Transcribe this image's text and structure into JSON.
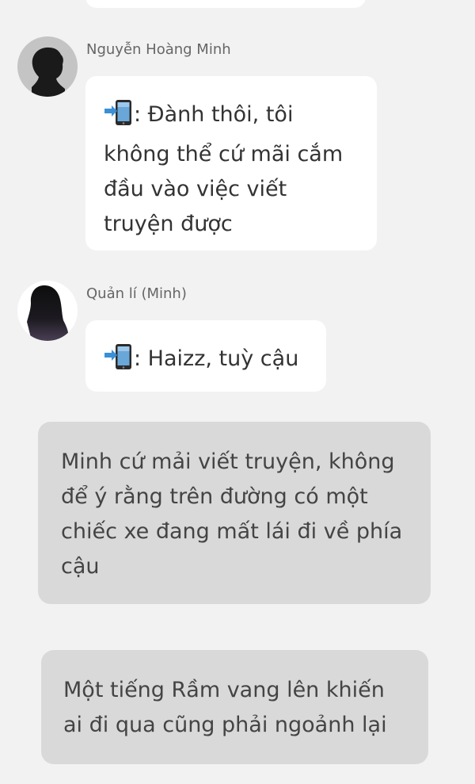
{
  "messages": [
    {
      "sender": "Nguyễn Hoàng Minh",
      "text": ": Đành thôi, tôi không thể cứ mãi cắm đầu vào việc viết truyện được"
    },
    {
      "sender": "Quản lí (Minh)",
      "text": ": Haizz, tuỳ cậu"
    }
  ],
  "narrations": [
    {
      "text": "Minh cứ mải viết truyện, không để ý rằng trên đường có một chiếc xe đang mất lái đi về phía cậu"
    },
    {
      "text": "Một tiếng Rầm vang lên khiến ai đi qua cũng phải ngoảnh lại"
    }
  ],
  "icons": {
    "phone_prefix": "phone-arrow-icon",
    "avatar_1": "male-silhouette-avatar",
    "avatar_2": "female-silhouette-avatar"
  }
}
